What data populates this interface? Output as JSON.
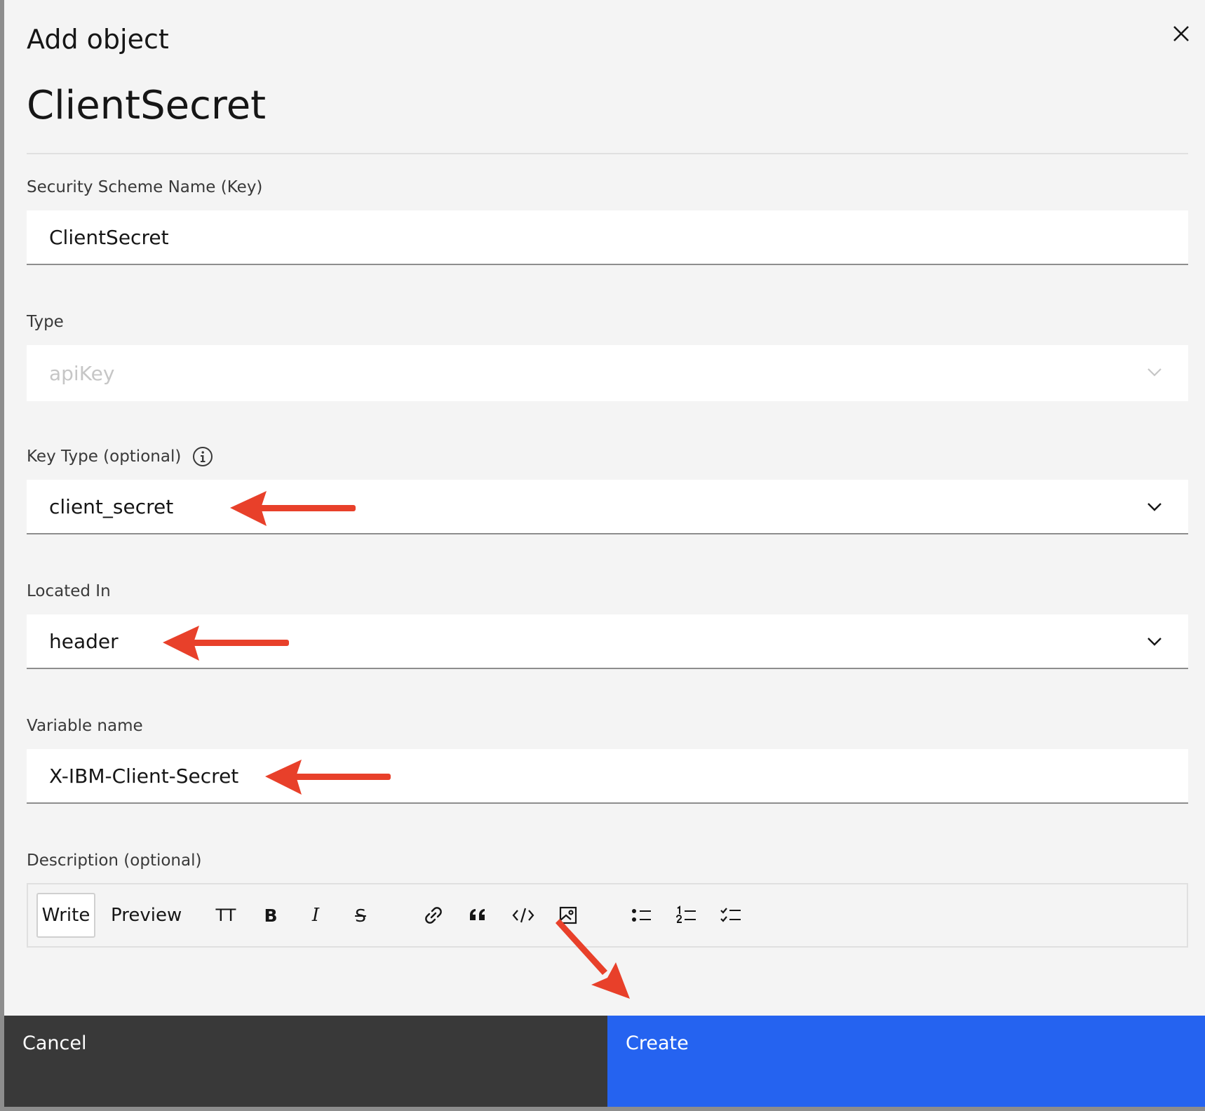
{
  "modal": {
    "subtitle": "Add object",
    "title": "ClientSecret"
  },
  "fields": {
    "scheme_name": {
      "label": "Security Scheme Name (Key)",
      "value": "ClientSecret"
    },
    "type": {
      "label": "Type",
      "value": "apiKey"
    },
    "key_type": {
      "label": "Key Type (optional)",
      "value": "client_secret"
    },
    "located_in": {
      "label": "Located In",
      "value": "header"
    },
    "variable_name": {
      "label": "Variable name",
      "value": "X-IBM-Client-Secret"
    },
    "description": {
      "label": "Description (optional)"
    }
  },
  "editor": {
    "tab_write": "Write",
    "tab_preview": "Preview",
    "heading_label": "TT",
    "bold_label": "B",
    "italic_label": "I",
    "strike_label": "S"
  },
  "footer": {
    "cancel_label": "Cancel",
    "create_label": "Create"
  },
  "colors": {
    "annotation_arrow": "#e8402a",
    "primary_button": "#2563f0",
    "secondary_button": "#393939"
  },
  "icons": [
    "close-icon",
    "info-icon",
    "chevron-down-icon",
    "link-icon",
    "quote-icon",
    "code-icon",
    "image-icon",
    "bullet-list-icon",
    "numbered-list-icon",
    "task-list-icon"
  ]
}
